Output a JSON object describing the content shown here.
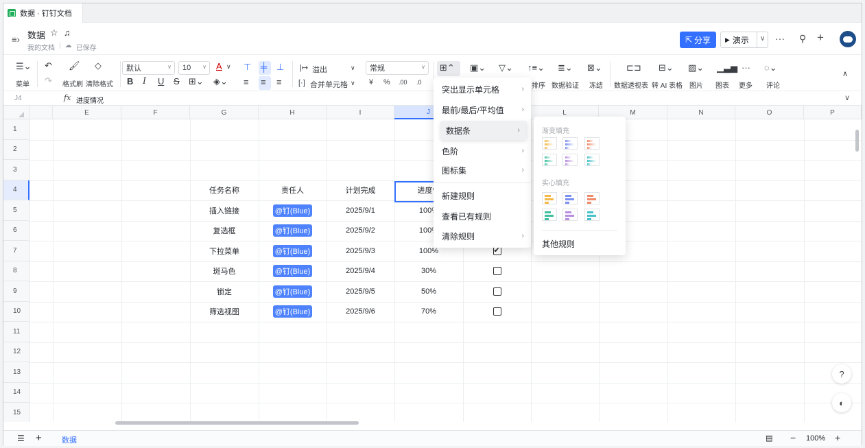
{
  "tab": {
    "title": "数据 · 钉钉文档"
  },
  "header": {
    "doc_title": "数据",
    "location": "我的文档",
    "save_status": "已保存",
    "share_label": "分享",
    "present_label": "演示"
  },
  "toolbar": {
    "menu": "菜单",
    "format_painter": "格式刷",
    "clear_format": "清除格式",
    "font": "默认",
    "font_size": "10",
    "overflow": "溢出",
    "merge": "合并单元格",
    "number_format": "常规",
    "currency": "¥",
    "percent": "%",
    "sort": "排序",
    "validation": "数据验证",
    "freeze": "冻结",
    "pivot": "数据透视表",
    "ai_table": "转 AI 表格",
    "image": "图片",
    "chart": "图表",
    "more": "更多",
    "comment": "评论"
  },
  "formula_bar": {
    "cell_ref": "J4",
    "fx": "fx",
    "value": "进度情况"
  },
  "grid": {
    "columns": [
      "E",
      "F",
      "G",
      "H",
      "I",
      "J",
      "K",
      "L",
      "M",
      "N",
      "O",
      "P"
    ],
    "rows": [
      "1",
      "2",
      "3",
      "4",
      "5",
      "6",
      "7",
      "8",
      "9",
      "10",
      "11",
      "12",
      "13",
      "14",
      "15"
    ],
    "headers": {
      "task": "任务名称",
      "owner": "责任人",
      "planned": "计划完成",
      "progress": "进度情"
    },
    "data": [
      {
        "task": "插入链接",
        "owner": "@钉(Blue)",
        "planned": "2025/9/1",
        "progress": "100%",
        "done": true
      },
      {
        "task": "复选框",
        "owner": "@钉(Blue)",
        "planned": "2025/9/2",
        "progress": "100%",
        "done": true
      },
      {
        "task": "下拉菜单",
        "owner": "@钉(Blue)",
        "planned": "2025/9/3",
        "progress": "100%",
        "done": true
      },
      {
        "task": "斑马色",
        "owner": "@钉(Blue)",
        "planned": "2025/9/4",
        "progress": "30%",
        "done": false
      },
      {
        "task": "锁定",
        "owner": "@钉(Blue)",
        "planned": "2025/9/5",
        "progress": "50%",
        "done": false
      },
      {
        "task": "筛选视图",
        "owner": "@钉(Blue)",
        "planned": "2025/9/6",
        "progress": "70%",
        "done": false
      }
    ]
  },
  "menu": {
    "items": [
      "突出显示单元格",
      "最前/最后/平均值",
      "数据条",
      "色阶",
      "图标集",
      "新建规则",
      "查看已有规则",
      "清除规则"
    ]
  },
  "submenu": {
    "gradient_title": "渐变填充",
    "solid_title": "实心填充",
    "other_rules": "其他规则",
    "bar_colors": [
      "#f5b94a",
      "#7b8ff0",
      "#ef8a6a",
      "#3fbf9f",
      "#b98de0",
      "#45c1c9"
    ]
  },
  "bottom": {
    "sheet_name": "数据",
    "zoom": "100%"
  },
  "colors": {
    "accent": "#3370ff",
    "sheet_green": "#1fae5a"
  }
}
